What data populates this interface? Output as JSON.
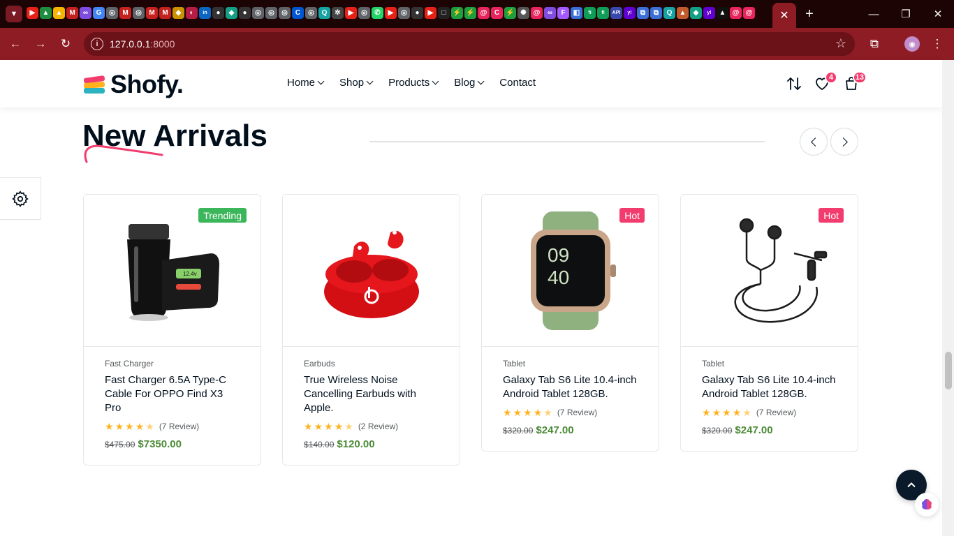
{
  "browser": {
    "favicons": [
      {
        "icon": "youtube-icon",
        "color": "#e62117",
        "glyph": "▶"
      },
      {
        "icon": "google-drive-icon",
        "color": "#1e8e3e",
        "glyph": "▲"
      },
      {
        "icon": "google-drive-icon",
        "color": "#f4b400",
        "glyph": "▲"
      },
      {
        "icon": "gmail-icon",
        "color": "#c5221f",
        "glyph": "M"
      },
      {
        "icon": "meta-icon",
        "color": "#7f4ce0",
        "glyph": "∞"
      },
      {
        "icon": "google-icon",
        "color": "#4285f4",
        "glyph": "G"
      },
      {
        "icon": "globe-icon",
        "color": "#5f6368",
        "glyph": "◎"
      },
      {
        "icon": "gmail-icon",
        "color": "#c5221f",
        "glyph": "M"
      },
      {
        "icon": "globe-icon",
        "color": "#5f6368",
        "glyph": "◎"
      },
      {
        "icon": "gmail-icon",
        "color": "#c5221f",
        "glyph": "M"
      },
      {
        "icon": "gmail-icon",
        "color": "#c5221f",
        "glyph": "M"
      },
      {
        "icon": "binance-icon",
        "color": "#c99400",
        "glyph": "◆"
      },
      {
        "icon": "app-icon",
        "color": "#b51d44",
        "glyph": "◐"
      },
      {
        "icon": "linkedin-icon",
        "color": "#0a66c2",
        "glyph": "in"
      },
      {
        "icon": "github-icon",
        "color": "#333333",
        "glyph": "●"
      },
      {
        "icon": "diamond-icon",
        "color": "#14a085",
        "glyph": "◆"
      },
      {
        "icon": "github-icon",
        "color": "#333333",
        "glyph": "●"
      },
      {
        "icon": "globe-icon",
        "color": "#5f6368",
        "glyph": "◎"
      },
      {
        "icon": "globe-icon",
        "color": "#5f6368",
        "glyph": "◎"
      },
      {
        "icon": "globe-icon",
        "color": "#5f6368",
        "glyph": "◎"
      },
      {
        "icon": "coursera-icon",
        "color": "#0056d2",
        "glyph": "C"
      },
      {
        "icon": "globe-icon",
        "color": "#5f6368",
        "glyph": "◎"
      },
      {
        "icon": "search-icon",
        "color": "#15a3a3",
        "glyph": "Q"
      },
      {
        "icon": "app-icon",
        "color": "#444444",
        "glyph": "✲"
      },
      {
        "icon": "youtube-icon",
        "color": "#e62117",
        "glyph": "▶"
      },
      {
        "icon": "globe-icon",
        "color": "#5f6368",
        "glyph": "◎"
      },
      {
        "icon": "whatsapp-icon",
        "color": "#25d366",
        "glyph": "✆"
      },
      {
        "icon": "youtube-icon",
        "color": "#e62117",
        "glyph": "▶"
      },
      {
        "icon": "globe-icon",
        "color": "#5f6368",
        "glyph": "◎"
      },
      {
        "icon": "github-icon",
        "color": "#333333",
        "glyph": "●"
      },
      {
        "icon": "youtube-icon",
        "color": "#e62117",
        "glyph": "▶"
      },
      {
        "icon": "app-icon",
        "color": "#222222",
        "glyph": "□"
      },
      {
        "icon": "app-icon",
        "color": "#1e9e3e",
        "glyph": "⚡"
      },
      {
        "icon": "app-icon",
        "color": "#1e9e3e",
        "glyph": "⚡"
      },
      {
        "icon": "app-icon",
        "color": "#e8245c",
        "glyph": "@"
      },
      {
        "icon": "app-icon",
        "color": "#e8245c",
        "glyph": "C"
      },
      {
        "icon": "app-icon",
        "color": "#1e9e3e",
        "glyph": "⚡"
      },
      {
        "icon": "openai-icon",
        "color": "#555555",
        "glyph": "✺"
      },
      {
        "icon": "app-icon",
        "color": "#e8245c",
        "glyph": "@"
      },
      {
        "icon": "meta-icon",
        "color": "#7f4ce0",
        "glyph": "∞"
      },
      {
        "icon": "figma-icon",
        "color": "#a259ff",
        "glyph": "F"
      },
      {
        "icon": "app-icon",
        "color": "#3a6fd8",
        "glyph": "◧"
      },
      {
        "icon": "app-icon",
        "color": "#0f9d58",
        "glyph": "fi"
      },
      {
        "icon": "app-icon",
        "color": "#0f9d58",
        "glyph": "fi"
      },
      {
        "icon": "app-icon",
        "color": "#3949ab",
        "glyph": "API"
      },
      {
        "icon": "yahoo-icon",
        "color": "#6001d2",
        "glyph": "y!"
      },
      {
        "icon": "app-icon",
        "color": "#3a6fd8",
        "glyph": "⧉"
      },
      {
        "icon": "app-icon",
        "color": "#3a6fd8",
        "glyph": "⧉"
      },
      {
        "icon": "search-icon",
        "color": "#15a3a3",
        "glyph": "Q"
      },
      {
        "icon": "app-icon",
        "color": "#c25b2c",
        "glyph": "▲"
      },
      {
        "icon": "diamond-icon",
        "color": "#14a085",
        "glyph": "◆"
      },
      {
        "icon": "yahoo-icon",
        "color": "#6001d2",
        "glyph": "y!"
      },
      {
        "icon": "app-icon",
        "color": "#111111",
        "glyph": "▲"
      },
      {
        "icon": "app-icon",
        "color": "#e8245c",
        "glyph": "@"
      },
      {
        "icon": "app-icon",
        "color": "#e8245c",
        "glyph": "@"
      }
    ],
    "url_host": "127.0.0.1",
    "url_port": ":8000"
  },
  "header": {
    "logo_text": "Shofy.",
    "nav": [
      {
        "label": "Home",
        "dropdown": true
      },
      {
        "label": "Shop",
        "dropdown": true
      },
      {
        "label": "Products",
        "dropdown": true
      },
      {
        "label": "Blog",
        "dropdown": true
      },
      {
        "label": "Contact",
        "dropdown": false
      }
    ],
    "wishlist_count": "4",
    "cart_count": "13"
  },
  "section": {
    "title": "New Arrivals"
  },
  "products": [
    {
      "badge": "Trending",
      "badge_color": "#3cb65b",
      "category": "Fast Charger",
      "title": "Fast Charger 6.5A Type-C Cable For OPPO Find X3 Pro",
      "rating": 4.5,
      "reviews": "(7 Review)",
      "old_price": "$475.00",
      "price": "$7350.00",
      "image": "car-charger"
    },
    {
      "badge": "",
      "badge_color": "",
      "category": "Earbuds",
      "title": "True Wireless Noise Cancelling Earbuds with Apple.",
      "rating": 4.5,
      "reviews": "(2 Review)",
      "old_price": "$140.00",
      "price": "$120.00",
      "image": "earbuds"
    },
    {
      "badge": "Hot",
      "badge_color": "#f23c6e",
      "category": "Tablet",
      "title": "Galaxy Tab S6 Lite 10.4-inch Android Tablet 128GB.",
      "rating": 4.5,
      "reviews": "(7 Review)",
      "old_price": "$320.00",
      "price": "$247.00",
      "image": "smartwatch"
    },
    {
      "badge": "Hot",
      "badge_color": "#f23c6e",
      "category": "Tablet",
      "title": "Galaxy Tab S6 Lite 10.4-inch Android Tablet 128GB.",
      "rating": 4.5,
      "reviews": "(7 Review)",
      "old_price": "$320.00",
      "price": "$247.00",
      "image": "earphones"
    }
  ],
  "colors": {
    "accent": "#f23c6e",
    "price_green": "#4c8a37",
    "star": "#ffb21d",
    "browser_frame": "#8d1c24"
  }
}
